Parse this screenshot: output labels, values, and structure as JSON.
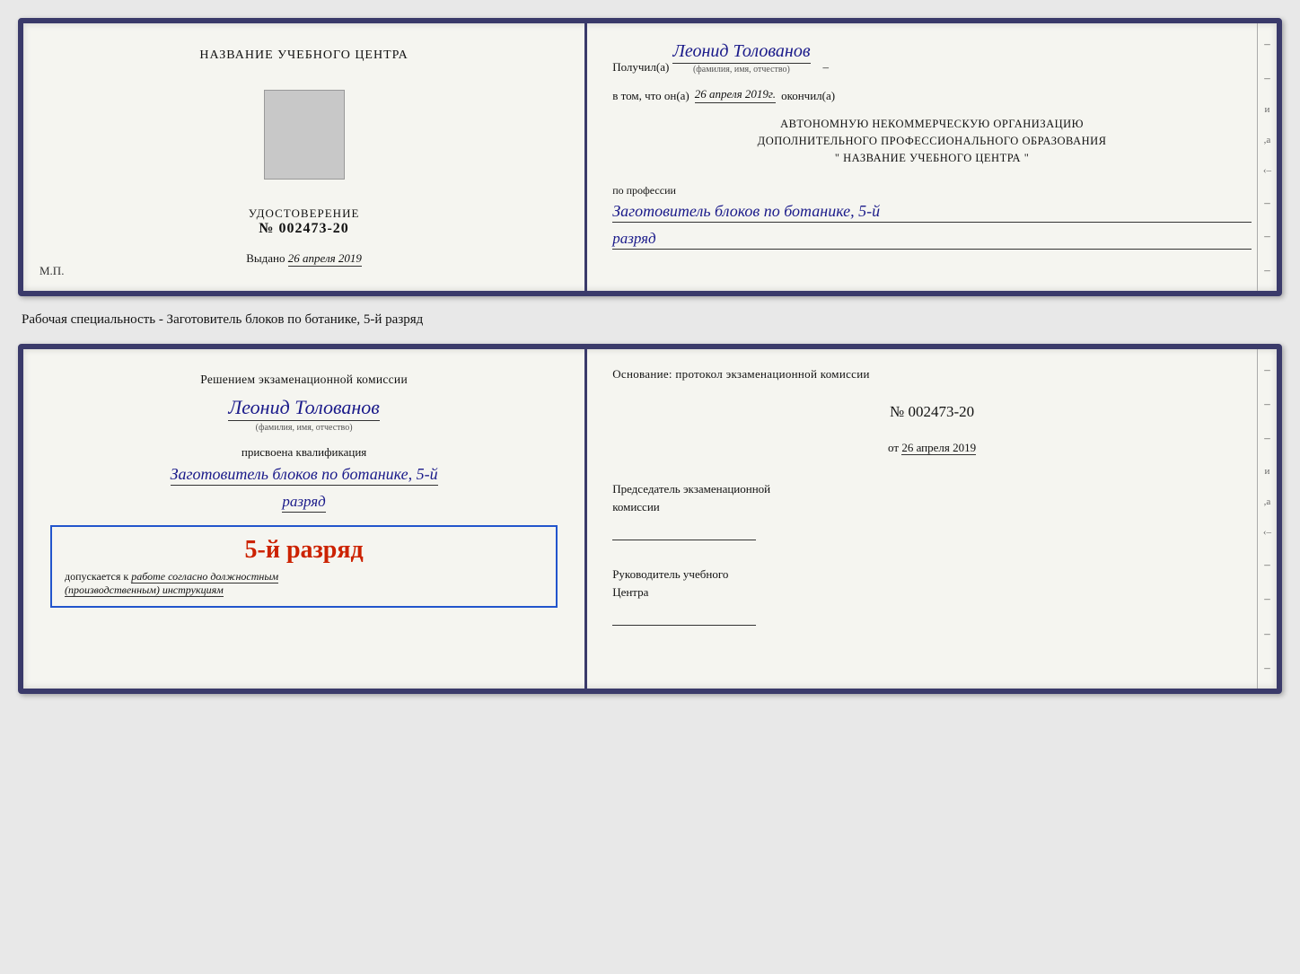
{
  "top_doc": {
    "left": {
      "center_title": "НАЗВАНИЕ УЧЕБНОГО ЦЕНТРА",
      "cert_label": "УДОСТОВЕРЕНИЕ",
      "cert_number": "№ 002473-20",
      "issued_prefix": "Выдано",
      "issued_date": "26 апреля 2019",
      "mp_label": "М.П."
    },
    "right": {
      "recipient_prefix": "Получил(а)",
      "recipient_name": "Леонид Толованов",
      "fio_caption": "(фамилия, имя, отчество)",
      "date_prefix": "в том, что он(а)",
      "date_value": "26 апреля 2019г.",
      "finished_label": "окончил(а)",
      "org_line1": "АВТОНОМНУЮ НЕКОММЕРЧЕСКУЮ ОРГАНИЗАЦИЮ",
      "org_line2": "ДОПОЛНИТЕЛЬНОГО ПРОФЕССИОНАЛЬНОГО ОБРАЗОВАНИЯ",
      "org_line3": "\"  НАЗВАНИЕ УЧЕБНОГО ЦЕНТРА  \"",
      "profession_label": "по профессии",
      "profession_value": "Заготовитель блоков по ботанике, 5-й",
      "rank_value": "разряд"
    }
  },
  "specialty_label": "Рабочая специальность - Заготовитель блоков по ботанике, 5-й разряд",
  "bottom_doc": {
    "left": {
      "commission_text": "Решением экзаменационной комиссии",
      "person_name": "Леонид Толованов",
      "fio_sub": "(фамилия, имя, отчество)",
      "qualification_text": "присвоена квалификация",
      "qual_value": "Заготовитель блоков по ботанике, 5-й",
      "rank_value": "разряд",
      "stamp_rank": "5-й разряд",
      "stamp_allowed": "допускается к",
      "stamp_italic": "работе согласно должностным",
      "stamp_italic2": "(производственным) инструкциям"
    },
    "right": {
      "basis_text": "Основание: протокол экзаменационной комиссии",
      "protocol_number": "№ 002473-20",
      "from_prefix": "от",
      "from_date": "26 апреля 2019",
      "chairman_label": "Председатель экзаменационной",
      "chairman_label2": "комиссии",
      "head_label": "Руководитель учебного",
      "head_label2": "Центра"
    }
  }
}
